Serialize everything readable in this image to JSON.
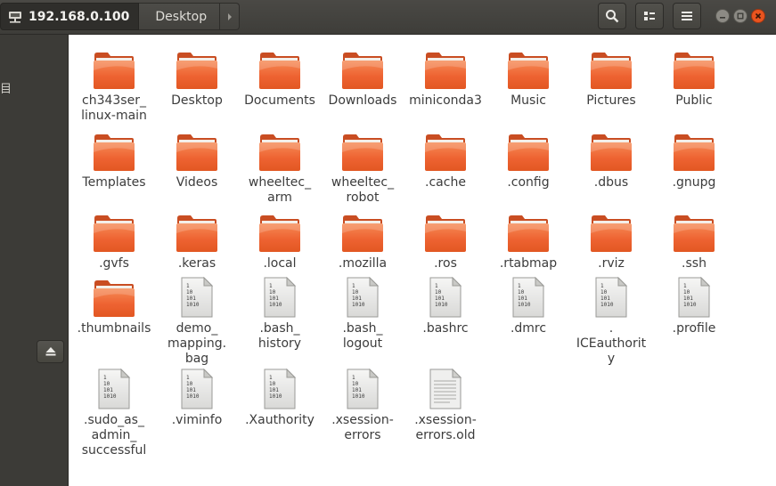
{
  "header": {
    "host": "192.168.0.100",
    "location": "Desktop"
  },
  "sidebar": {
    "fragment": "目"
  },
  "files": [
    {
      "label": "ch343ser_\nlinux-main",
      "icon": "folder-icon"
    },
    {
      "label": "Desktop",
      "icon": "folder-icon"
    },
    {
      "label": "Documents",
      "icon": "folder-icon"
    },
    {
      "label": "Downloads",
      "icon": "folder-icon"
    },
    {
      "label": "miniconda3",
      "icon": "folder-icon"
    },
    {
      "label": "Music",
      "icon": "folder-icon"
    },
    {
      "label": "Pictures",
      "icon": "folder-icon"
    },
    {
      "label": "Public",
      "icon": "folder-icon"
    },
    {
      "label": "Templates",
      "icon": "folder-icon"
    },
    {
      "label": "Videos",
      "icon": "folder-icon"
    },
    {
      "label": "wheeltec_\narm",
      "icon": "folder-icon"
    },
    {
      "label": "wheeltec_\nrobot",
      "icon": "folder-icon"
    },
    {
      "label": ".cache",
      "icon": "folder-icon"
    },
    {
      "label": ".config",
      "icon": "folder-icon"
    },
    {
      "label": ".dbus",
      "icon": "folder-icon"
    },
    {
      "label": ".gnupg",
      "icon": "folder-icon"
    },
    {
      "label": ".gvfs",
      "icon": "folder-icon"
    },
    {
      "label": ".keras",
      "icon": "folder-icon"
    },
    {
      "label": ".local",
      "icon": "folder-icon"
    },
    {
      "label": ".mozilla",
      "icon": "folder-icon"
    },
    {
      "label": ".ros",
      "icon": "folder-icon"
    },
    {
      "label": ".rtabmap",
      "icon": "folder-icon"
    },
    {
      "label": ".rviz",
      "icon": "folder-icon"
    },
    {
      "label": ".ssh",
      "icon": "folder-icon"
    },
    {
      "label": ".thumbnails",
      "icon": "folder-icon"
    },
    {
      "label": "demo_\nmapping.\nbag",
      "icon": "binary-file-icon"
    },
    {
      "label": ".bash_\nhistory",
      "icon": "binary-file-icon"
    },
    {
      "label": ".bash_\nlogout",
      "icon": "binary-file-icon"
    },
    {
      "label": ".bashrc",
      "icon": "binary-file-icon"
    },
    {
      "label": ".dmrc",
      "icon": "binary-file-icon"
    },
    {
      "label": ".\nICEauthorit\ny",
      "icon": "binary-file-icon"
    },
    {
      "label": ".profile",
      "icon": "binary-file-icon"
    },
    {
      "label": ".sudo_as_\nadmin_\nsuccessful",
      "icon": "binary-file-icon"
    },
    {
      "label": ".viminfo",
      "icon": "binary-file-icon"
    },
    {
      "label": ".Xauthority",
      "icon": "binary-file-icon"
    },
    {
      "label": ".xsession-\nerrors",
      "icon": "binary-file-icon"
    },
    {
      "label": ".xsession-\nerrors.old",
      "icon": "text-file-icon"
    }
  ],
  "binary_glyph": [
    "1",
    "10",
    "101",
    "1010"
  ],
  "colors": {
    "folder_orange": "#f06a3b",
    "close_red": "#e9541f",
    "header_dark": "#3e3d39"
  }
}
